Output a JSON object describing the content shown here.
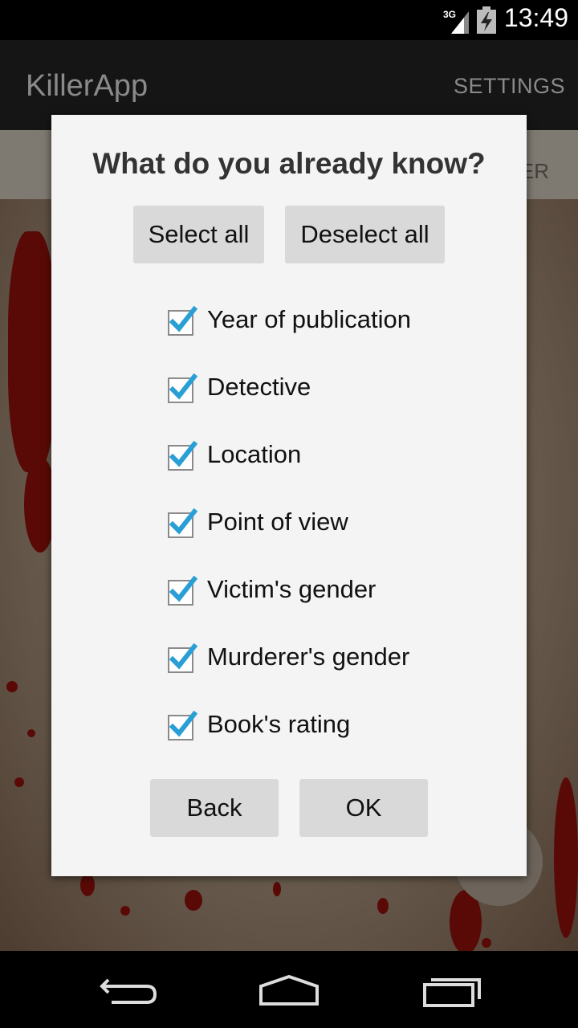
{
  "status_bar": {
    "time": "13:49",
    "network": "3G",
    "icons": [
      "signal-icon",
      "battery-charging-icon"
    ]
  },
  "action_bar": {
    "title": "KillerApp",
    "settings_label": "SETTINGS"
  },
  "background_tab": {
    "partial_label": "ER"
  },
  "dialog": {
    "title": "What do you already know?",
    "select_all_label": "Select all",
    "deselect_all_label": "Deselect all",
    "options": [
      {
        "label": "Year of publication",
        "checked": true
      },
      {
        "label": "Detective",
        "checked": true
      },
      {
        "label": "Location",
        "checked": true
      },
      {
        "label": "Point of view",
        "checked": true
      },
      {
        "label": "Victim's gender",
        "checked": true
      },
      {
        "label": "Murderer's gender",
        "checked": true
      },
      {
        "label": "Book's rating",
        "checked": true
      }
    ],
    "back_label": "Back",
    "ok_label": "OK"
  },
  "nav_bar": {
    "icons": [
      "back-icon",
      "home-icon",
      "recents-icon"
    ]
  },
  "colors": {
    "checkmark": "#2a9fd6",
    "dialog_bg": "#f4f4f4",
    "button_bg": "#d9d9d9"
  }
}
